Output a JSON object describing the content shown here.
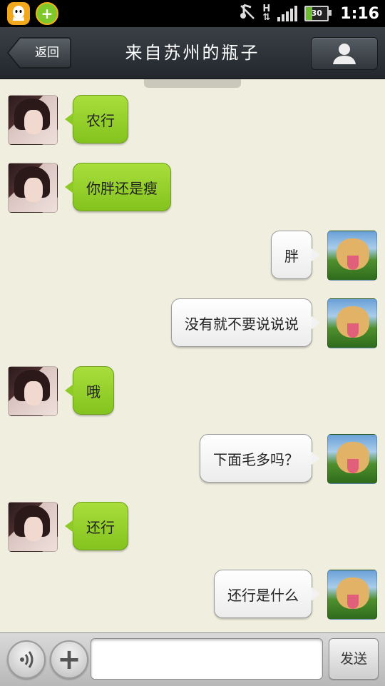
{
  "status_bar": {
    "left_icons": [
      "qq-icon",
      "security-app-icon"
    ],
    "right_icons": [
      "music-muted-icon",
      "network-h-icon",
      "signal-icon",
      "battery-icon"
    ],
    "network_type": "H",
    "battery_level": "30",
    "time": "1:16"
  },
  "header": {
    "back_label": "返回",
    "title": "来自苏州的瓶子",
    "contact_icon": "person-icon"
  },
  "chat": {
    "timestamp_partial": "",
    "messages": [
      {
        "side": "in",
        "text": "农行",
        "avatar": "girl-avatar"
      },
      {
        "side": "in",
        "text": "你胖还是瘦",
        "avatar": "girl-avatar"
      },
      {
        "side": "out",
        "text": "胖",
        "avatar": "dog-avatar"
      },
      {
        "side": "out",
        "text": "没有就不要说说说",
        "avatar": "dog-avatar"
      },
      {
        "side": "in",
        "text": "哦",
        "avatar": "girl-avatar"
      },
      {
        "side": "out",
        "text": "下面毛多吗？",
        "avatar": "dog-avatar"
      },
      {
        "side": "in",
        "text": "还行",
        "avatar": "girl-avatar"
      },
      {
        "side": "out",
        "text": "还行是什么",
        "avatar": "dog-avatar"
      }
    ]
  },
  "input_bar": {
    "voice_icon": "voice-icon",
    "plus_icon": "plus-icon",
    "input_value": "",
    "send_label": "发送"
  },
  "colors": {
    "background": "#f0efdf",
    "incoming_bubble": "#95cc2a",
    "outgoing_bubble": "#ffffff",
    "titlebar": "#2b3036"
  }
}
